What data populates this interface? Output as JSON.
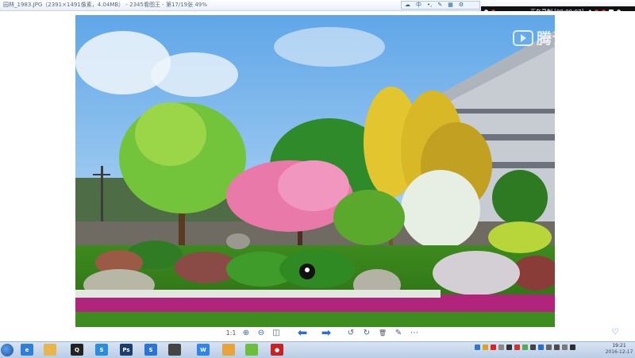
{
  "titlebar": {
    "title": "园林_1983.JPG（2391×1491像素，4.04MB） - 2345看图王 - 第17/19张 49%",
    "ime_items": [
      "☁",
      "中",
      "•,",
      "✎",
      "▦",
      "⚙"
    ]
  },
  "recorder": {
    "status": "正在录制 [00:00:07]"
  },
  "watermark": {
    "text": "腾讯视频"
  },
  "viewer": {
    "toolbar": [
      {
        "name": "actual-size-button",
        "glyph": "1:1"
      },
      {
        "name": "zoom-in-button",
        "glyph": "⊕"
      },
      {
        "name": "zoom-out-button",
        "glyph": "⊖"
      },
      {
        "name": "fit-window-button",
        "glyph": "◫"
      },
      {
        "name": "previous-image-button",
        "glyph": "⬅"
      },
      {
        "name": "next-image-button",
        "glyph": "➡"
      },
      {
        "name": "rotate-left-button",
        "glyph": "↺"
      },
      {
        "name": "rotate-right-button",
        "glyph": "↻"
      },
      {
        "name": "delete-button",
        "glyph": "🗑"
      },
      {
        "name": "edit-button",
        "glyph": "✎"
      },
      {
        "name": "more-button",
        "glyph": "⋯"
      }
    ],
    "help_glyph": "♡"
  },
  "taskbar": {
    "icons": [
      {
        "name": "ie-icon",
        "label": "e",
        "color": "#2f7fd8"
      },
      {
        "name": "explorer-icon",
        "label": "",
        "color": "#e8b64a"
      },
      {
        "name": "qq-icon",
        "label": "Q",
        "color": "#222"
      },
      {
        "name": "browser-icon",
        "label": "S",
        "color": "#2b8de0"
      },
      {
        "name": "photoshop-icon",
        "label": "Ps",
        "color": "#1c3d73"
      },
      {
        "name": "sogou-icon",
        "label": "S",
        "color": "#2a73d8"
      },
      {
        "name": "media-icon",
        "label": "",
        "color": "#444"
      },
      {
        "name": "wps-writer-icon",
        "label": "W",
        "color": "#2f86e6"
      },
      {
        "name": "folder-icon",
        "label": "",
        "color": "#e8a33a"
      },
      {
        "name": "image-viewer-icon",
        "label": "",
        "color": "#6bbf3a"
      },
      {
        "name": "record-icon",
        "label": "●",
        "color": "#cc1f1f"
      }
    ],
    "clock_time": "19:21",
    "clock_date": "2016-12-17"
  }
}
